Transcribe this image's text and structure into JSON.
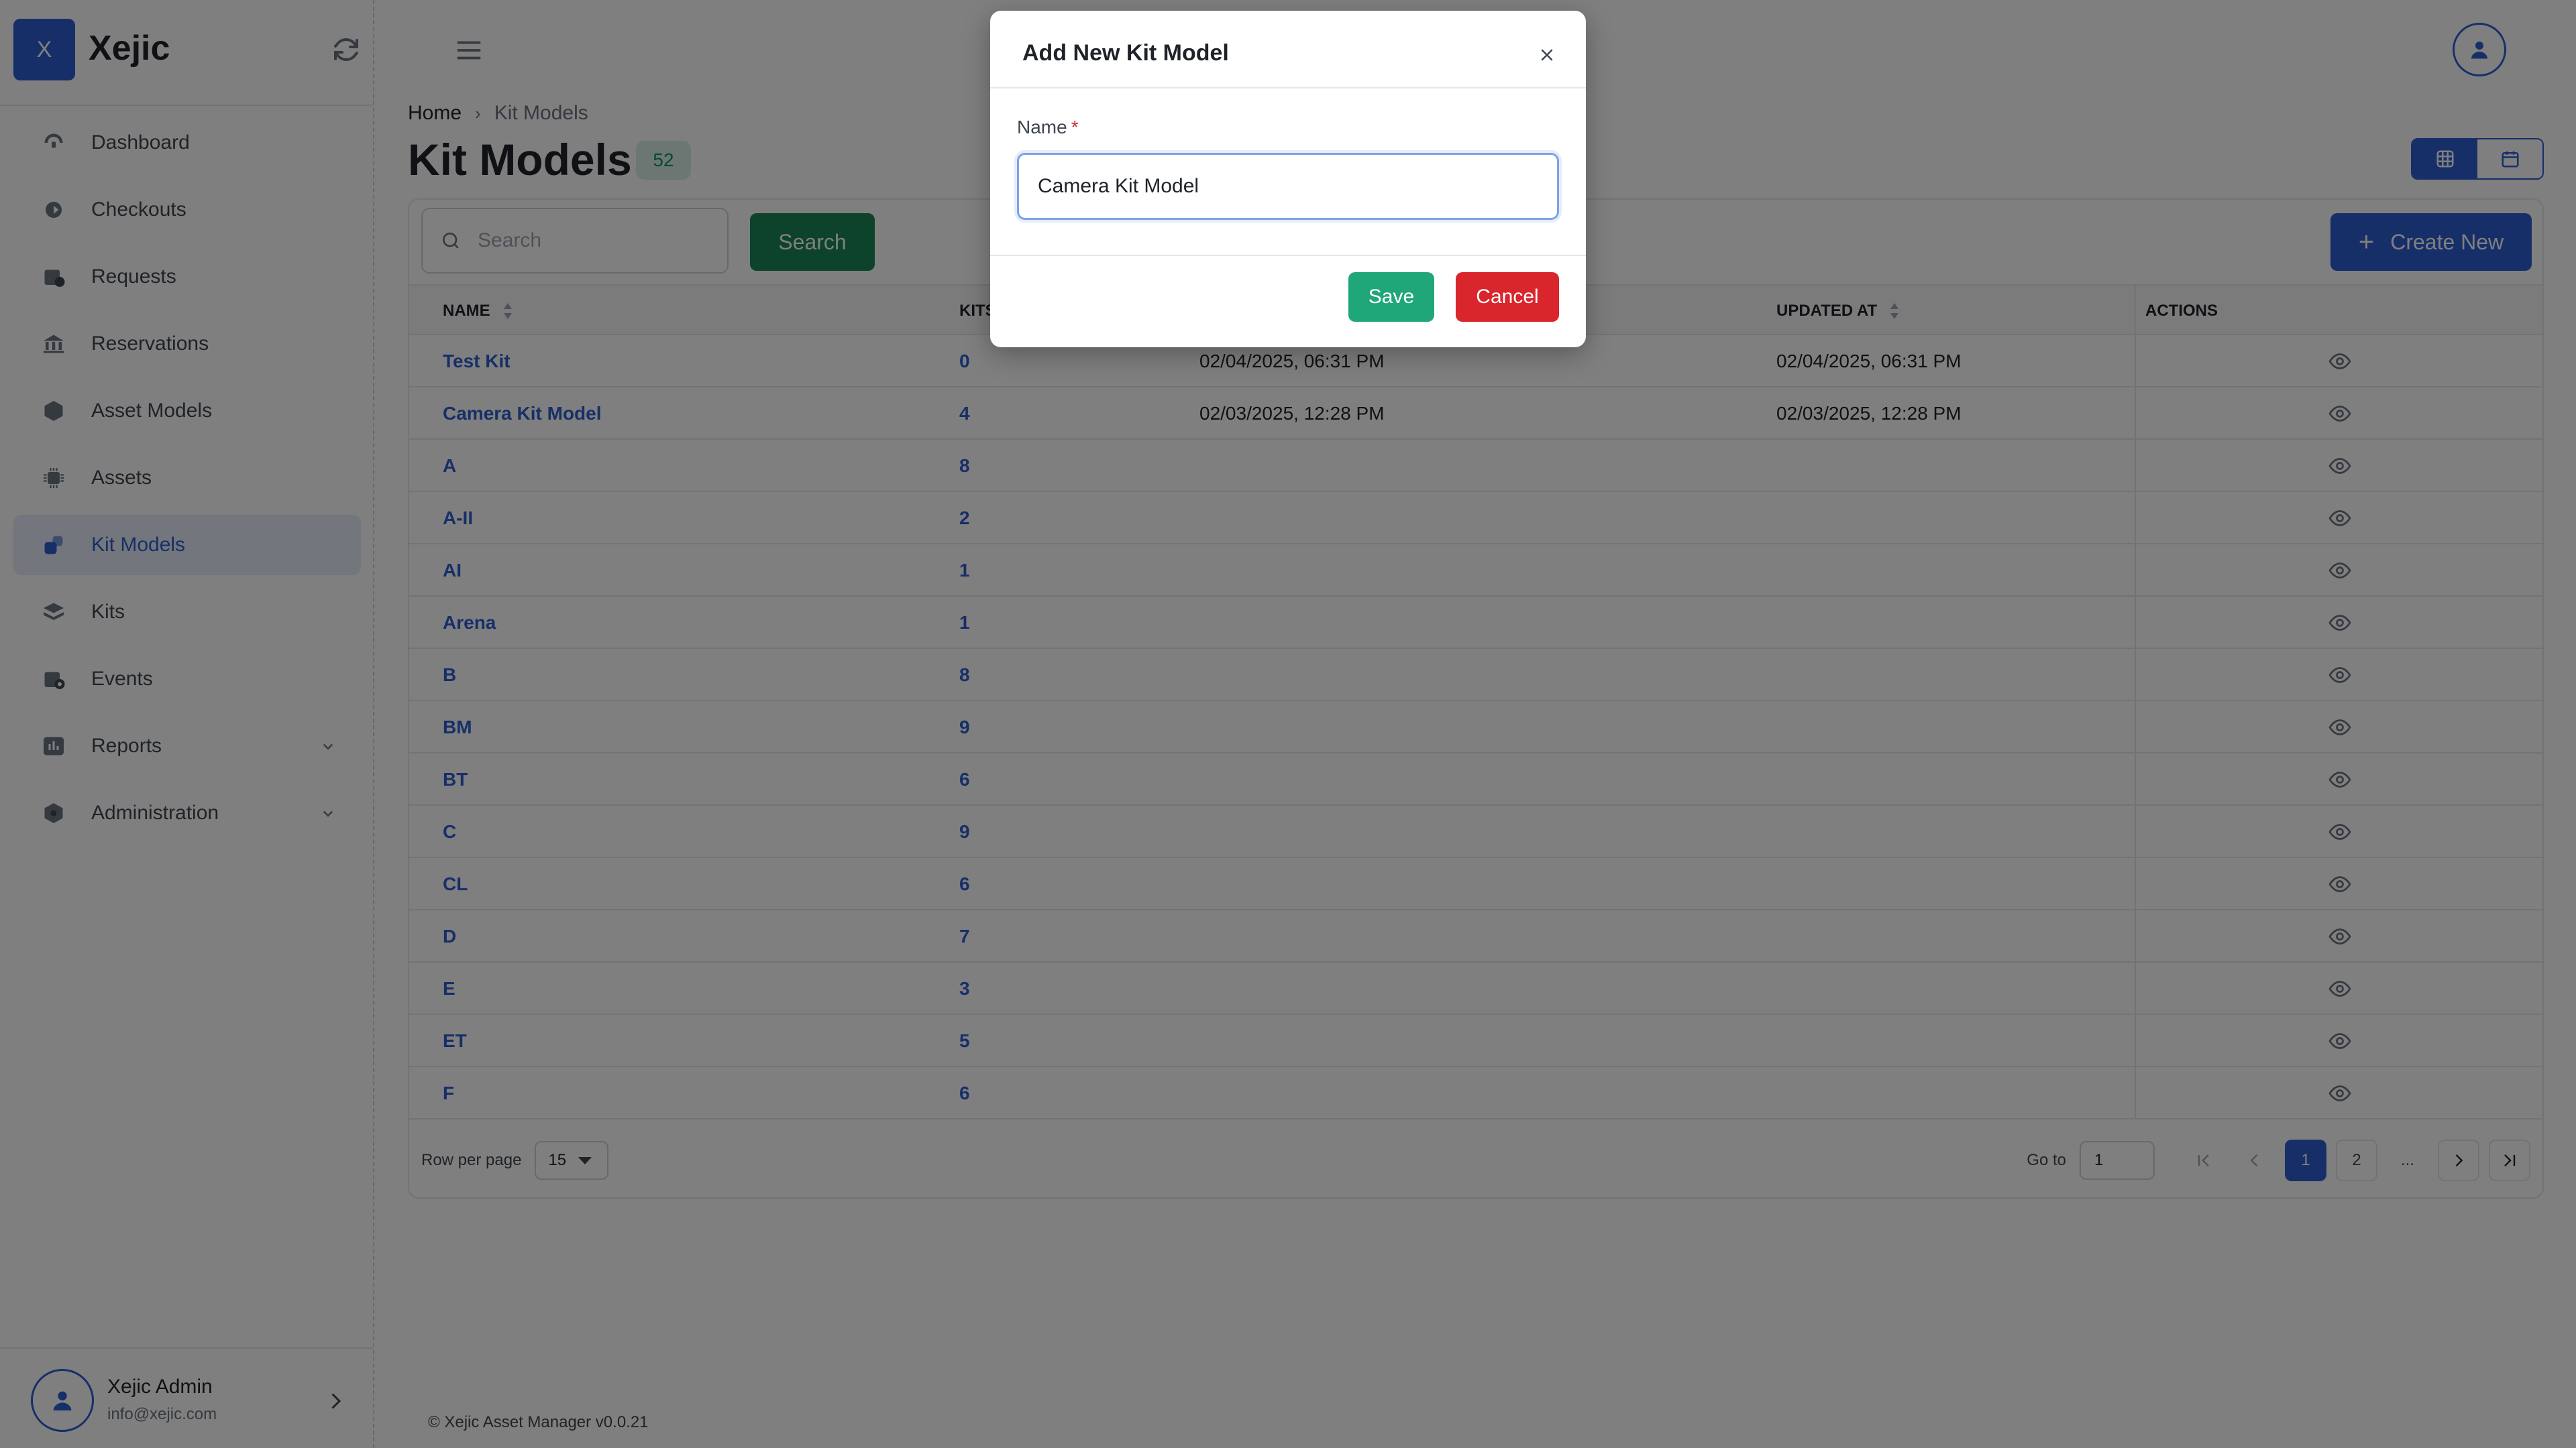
{
  "app": {
    "logo_letter": "X",
    "name": "Xejic"
  },
  "sidebar": {
    "items": [
      {
        "label": "Dashboard",
        "icon": "dashboard-icon"
      },
      {
        "label": "Checkouts",
        "icon": "checkout-icon"
      },
      {
        "label": "Requests",
        "icon": "calendar-clock-icon"
      },
      {
        "label": "Reservations",
        "icon": "building-icon"
      },
      {
        "label": "Asset Models",
        "icon": "cube-icon"
      },
      {
        "label": "Assets",
        "icon": "chip-icon"
      },
      {
        "label": "Kit Models",
        "icon": "kit-models-icon",
        "active": true
      },
      {
        "label": "Kits",
        "icon": "layers-icon"
      },
      {
        "label": "Events",
        "icon": "calendar-gear-icon"
      },
      {
        "label": "Reports",
        "icon": "chart-icon",
        "expandable": true
      },
      {
        "label": "Administration",
        "icon": "shield-gear-icon",
        "expandable": true
      }
    ],
    "user": {
      "name": "Xejic Admin",
      "email": "info@xejic.com"
    }
  },
  "breadcrumb": {
    "home": "Home",
    "current": "Kit Models"
  },
  "page": {
    "title": "Kit Models",
    "count": "52"
  },
  "toolbar": {
    "search_placeholder": "Search",
    "search_label": "Search",
    "create_label": "Create New"
  },
  "table": {
    "headers": {
      "name": "NAME",
      "kits": "KITS",
      "updated": "UPDATED AT",
      "actions": "ACTIONS"
    },
    "rows": [
      {
        "name": "Test Kit",
        "kits": "0",
        "created": "02/04/2025, 06:31 PM",
        "updated": "02/04/2025, 06:31 PM"
      },
      {
        "name": "Camera Kit Model",
        "kits": "4",
        "created": "02/03/2025, 12:28 PM",
        "updated": "02/03/2025, 12:28 PM"
      },
      {
        "name": "A",
        "kits": "8",
        "created": "",
        "updated": ""
      },
      {
        "name": "A-II",
        "kits": "2",
        "created": "",
        "updated": ""
      },
      {
        "name": "AI",
        "kits": "1",
        "created": "",
        "updated": ""
      },
      {
        "name": "Arena",
        "kits": "1",
        "created": "",
        "updated": ""
      },
      {
        "name": "B",
        "kits": "8",
        "created": "",
        "updated": ""
      },
      {
        "name": "BM",
        "kits": "9",
        "created": "",
        "updated": ""
      },
      {
        "name": "BT",
        "kits": "6",
        "created": "",
        "updated": ""
      },
      {
        "name": "C",
        "kits": "9",
        "created": "",
        "updated": ""
      },
      {
        "name": "CL",
        "kits": "6",
        "created": "",
        "updated": ""
      },
      {
        "name": "D",
        "kits": "7",
        "created": "",
        "updated": ""
      },
      {
        "name": "E",
        "kits": "3",
        "created": "",
        "updated": ""
      },
      {
        "name": "ET",
        "kits": "5",
        "created": "",
        "updated": ""
      },
      {
        "name": "F",
        "kits": "6",
        "created": "",
        "updated": ""
      }
    ]
  },
  "pagination": {
    "rows_label": "Row per page",
    "rows_value": "15",
    "goto_label": "Go to",
    "goto_value": "1",
    "pages": [
      "1",
      "2"
    ],
    "ellipsis": "...",
    "current_page": "1"
  },
  "footer": "© Xejic Asset Manager v0.0.21",
  "modal": {
    "title": "Add New Kit Model",
    "field_label": "Name",
    "required_mark": "*",
    "field_value": "Camera Kit Model",
    "save_label": "Save",
    "cancel_label": "Cancel"
  },
  "colors": {
    "primary": "#2f5fd1",
    "search_button": "#198754",
    "save_button": "#20a779",
    "cancel_button": "#d9252c",
    "badge_bg": "#d8efe7"
  }
}
